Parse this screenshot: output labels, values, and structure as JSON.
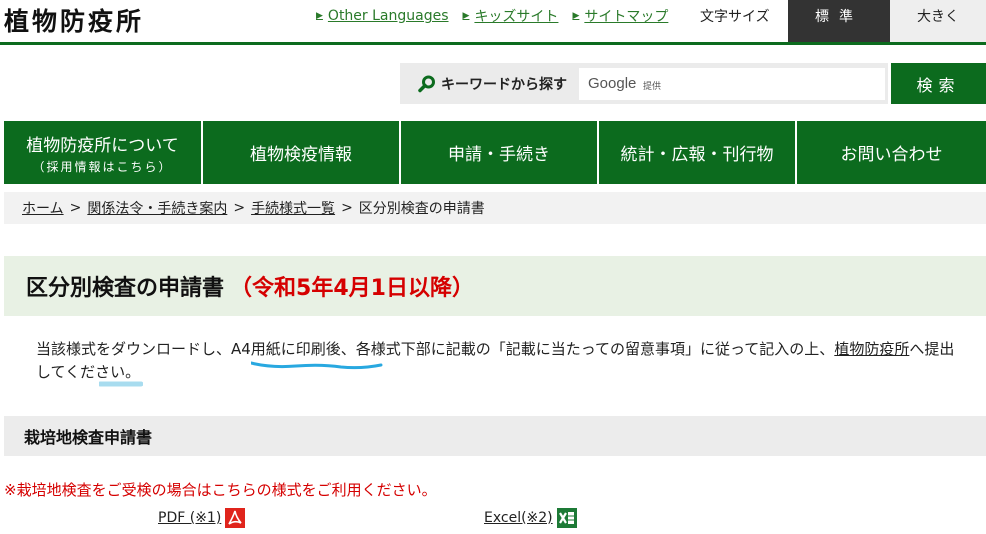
{
  "header": {
    "site_title": "植物防疫所",
    "links": [
      "Other Languages",
      "キッズサイト",
      "サイトマップ"
    ],
    "font_size_label": "文字サイズ",
    "font_size_standard": "標準",
    "font_size_large": "大きく"
  },
  "search": {
    "label": "キーワードから探す",
    "google_word": "Google",
    "google_sub": "提供",
    "button": "検索"
  },
  "nav": [
    {
      "label": "植物防疫所について",
      "sub": "（採用情報はこちら）"
    },
    {
      "label": "植物検疫情報",
      "sub": ""
    },
    {
      "label": "申請・手続き",
      "sub": ""
    },
    {
      "label": "統計・広報・刊行物",
      "sub": ""
    },
    {
      "label": "お問い合わせ",
      "sub": ""
    }
  ],
  "breadcrumb": {
    "home": "ホーム",
    "crumb1": "関係法令・手続き案内",
    "crumb2": "手続様式一覧",
    "current": "区分別検査の申請書",
    "sep": ">"
  },
  "page": {
    "title": "区分別検査の申請書",
    "title_red": "（令和5年4月1日以降）",
    "intro_1": "当該様式をダウンロードし、A4用紙に印刷後、各様式下部に記載の「記載に当たっての留意事項」に従って記入の上、",
    "intro_link": "植物防疫所",
    "intro_2": "へ提出してください。"
  },
  "section": {
    "heading": "栽培地検査申請書",
    "notice": "※栽培地検査をご受検の場合はこちらの様式をご利用ください。",
    "pdf_label": "PDF (※1)",
    "excel_label": "Excel(※2)"
  },
  "colors": {
    "brand_green": "#0c6b1e",
    "red": "#d50000",
    "pdf_red": "#e0241c",
    "excel_green": "#1d7a36"
  },
  "icons": {
    "search": "magnifier-icon",
    "pdf": "pdf-icon",
    "excel": "excel-icon",
    "link_marker": "triangle-right-icon"
  }
}
